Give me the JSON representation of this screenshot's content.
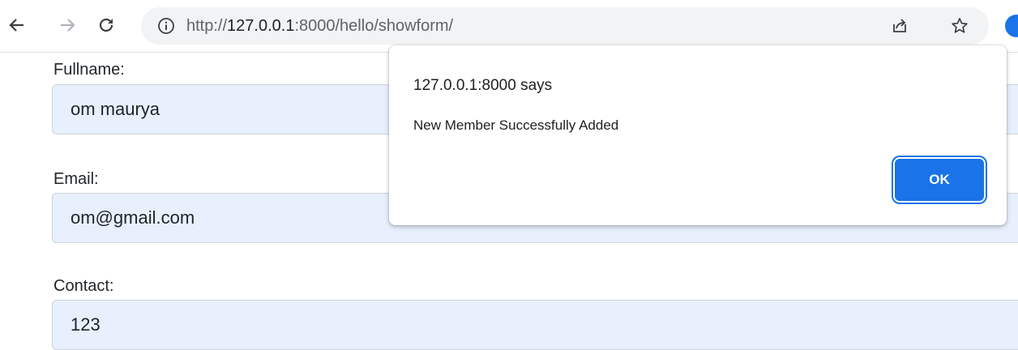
{
  "browser": {
    "url_prefix": "http://",
    "url_host": "127.0.0.1",
    "url_rest": ":8000/hello/showform/",
    "icons": {
      "back": "arrow-left-icon",
      "forward": "arrow-right-icon",
      "reload": "reload-icon",
      "info": "info-icon",
      "share": "share-icon",
      "bookmark": "star-icon",
      "profile": "profile-icon"
    }
  },
  "form": {
    "fields": [
      {
        "label": "Fullname:",
        "value": "om maurya"
      },
      {
        "label": "Email:",
        "value": "om@gmail.com"
      },
      {
        "label": "Contact:",
        "value": "123"
      }
    ],
    "input_bg": "#e8f0fe"
  },
  "dialog": {
    "title": "127.0.0.1:8000 says",
    "message": "New Member Successfully Added",
    "ok_label": "OK",
    "accent": "#1a73e8"
  }
}
